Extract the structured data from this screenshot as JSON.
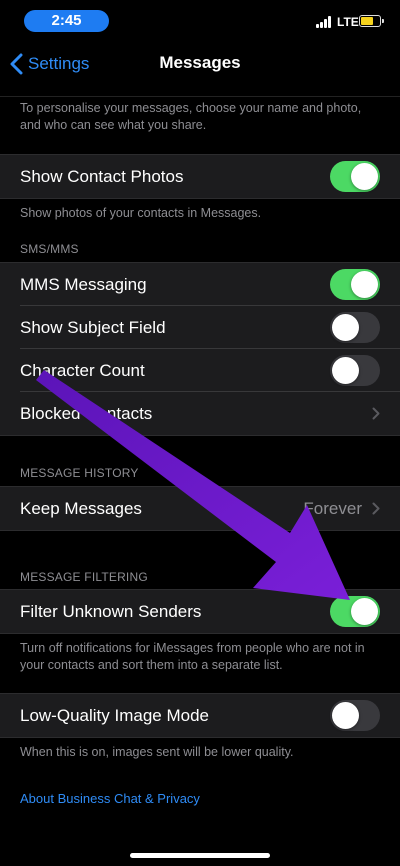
{
  "status_bar": {
    "time": "2:45",
    "network": "LTE"
  },
  "nav": {
    "back_label": "Settings",
    "title": "Messages"
  },
  "intro_text": "To personalise your messages, choose your name and photo, and who can see what you share.",
  "contact_photos": {
    "label": "Show Contact Photos",
    "enabled": true,
    "footer": "Show photos of your contacts in Messages."
  },
  "sms_mms": {
    "header": "SMS/MMS",
    "rows": [
      {
        "label": "MMS Messaging",
        "enabled": true
      },
      {
        "label": "Show Subject Field",
        "enabled": false
      },
      {
        "label": "Character Count",
        "enabled": false
      },
      {
        "label": "Blocked Contacts"
      }
    ]
  },
  "message_history": {
    "header": "MESSAGE HISTORY",
    "keep_label": "Keep Messages",
    "keep_value": "Forever"
  },
  "message_filtering": {
    "header": "MESSAGE FILTERING",
    "label": "Filter Unknown Senders",
    "enabled": true,
    "footer": "Turn off notifications for iMessages from people who are not in your contacts and sort them into a separate list."
  },
  "low_quality": {
    "label": "Low-Quality Image Mode",
    "enabled": false,
    "footer": "When this is on, images sent will be lower quality."
  },
  "about_link": "About Business Chat & Privacy",
  "colors": {
    "accent": "#2f8cf6",
    "toggle_on": "#4cd964",
    "annotation_arrow": "#6a18c9"
  }
}
